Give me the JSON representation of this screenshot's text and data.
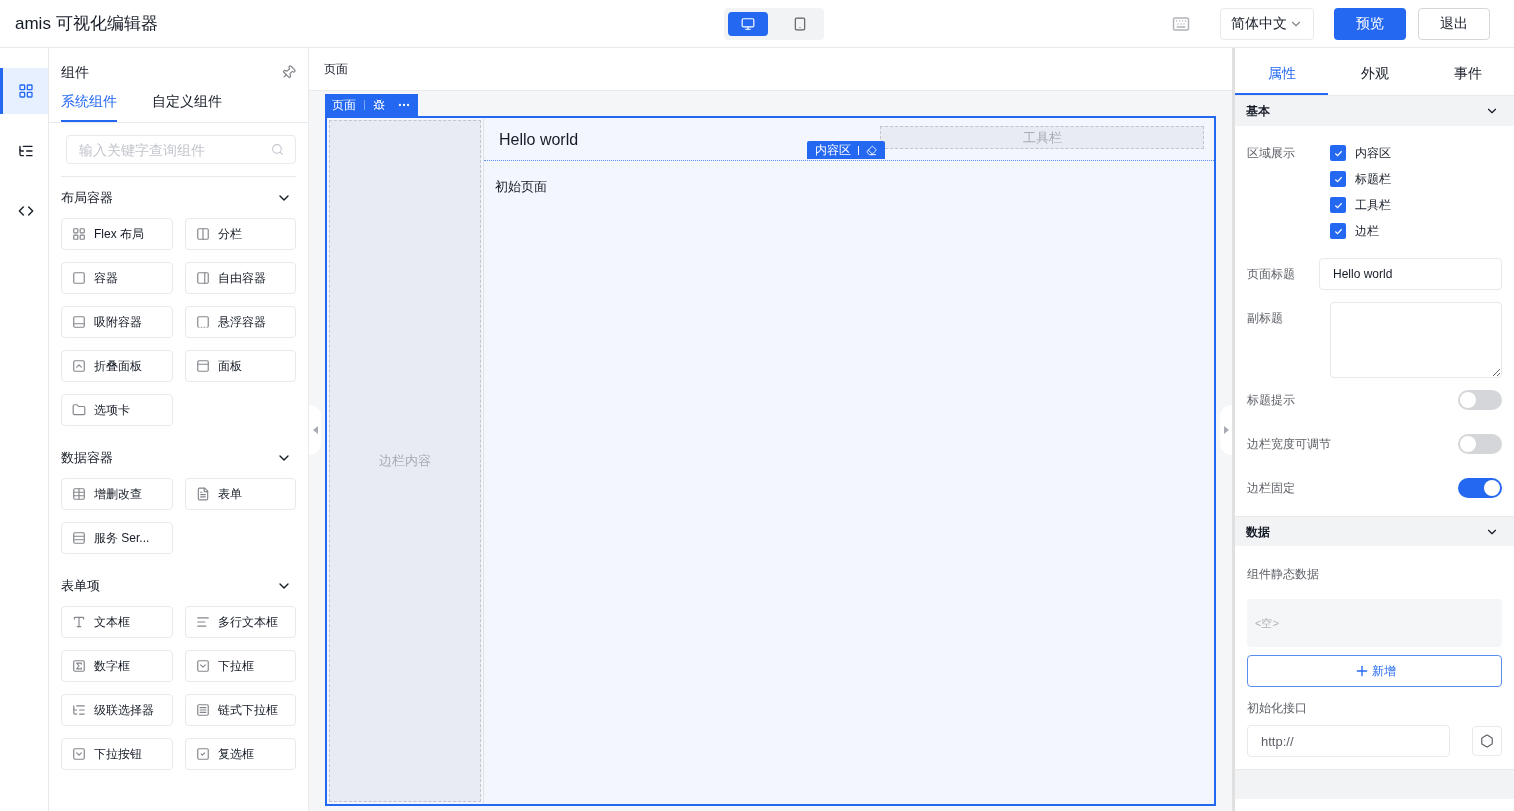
{
  "header": {
    "title": "amis 可视化编辑器",
    "devices": [
      {
        "kind": "desktop",
        "selected": true
      },
      {
        "kind": "tablet",
        "selected": false
      }
    ],
    "language": "简体中文",
    "buttons": [
      {
        "label": "预览",
        "kind": "primary"
      },
      {
        "label": "退出",
        "kind": "default"
      }
    ]
  },
  "rail": [
    {
      "kind": "components",
      "selected": true
    },
    {
      "kind": "outline",
      "selected": false
    },
    {
      "kind": "code",
      "selected": false
    }
  ],
  "components_panel": {
    "title": "组件",
    "tabs": [
      {
        "label": "系统组件",
        "selected": true
      },
      {
        "label": "自定义组件",
        "selected": false
      }
    ],
    "search": {
      "placeholder": "输入关键字查询组件"
    },
    "groups": [
      {
        "title": "布局容器",
        "expanded": true,
        "items": [
          {
            "label": "Flex 布局",
            "kind": "flex"
          },
          {
            "label": "分栏",
            "kind": "columns"
          },
          {
            "label": "容器",
            "kind": "container"
          },
          {
            "label": "自由容器",
            "kind": "free"
          },
          {
            "label": "吸附容器",
            "kind": "sticky"
          },
          {
            "label": "悬浮容器",
            "kind": "float"
          },
          {
            "label": "折叠面板",
            "kind": "collapse"
          },
          {
            "label": "面板",
            "kind": "panel"
          },
          {
            "label": "选项卡",
            "kind": "tabs"
          }
        ]
      },
      {
        "title": "数据容器",
        "expanded": true,
        "items": [
          {
            "label": "增删改查",
            "kind": "crud"
          },
          {
            "label": "表单",
            "kind": "form"
          },
          {
            "label": "服务 Ser...",
            "kind": "service"
          }
        ]
      },
      {
        "title": "表单项",
        "expanded": true,
        "items": [
          {
            "label": "文本框",
            "kind": "text"
          },
          {
            "label": "多行文本框",
            "kind": "textarea"
          },
          {
            "label": "数字框",
            "kind": "number"
          },
          {
            "label": "下拉框",
            "kind": "select"
          },
          {
            "label": "级联选择器",
            "kind": "cascader"
          },
          {
            "label": "链式下拉框",
            "kind": "chained"
          },
          {
            "label": "下拉按钮",
            "kind": "dropdown"
          },
          {
            "label": "复选框",
            "kind": "checkbox"
          }
        ]
      }
    ]
  },
  "canvas": {
    "breadcrumb": "页面",
    "page_tag": "页面",
    "title": "Hello world",
    "toolbar": "工具栏",
    "region_tag": "内容区",
    "body": "初始页面",
    "aside": "边栏内容"
  },
  "settings": {
    "tabs": [
      {
        "label": "属性",
        "selected": true
      },
      {
        "label": "外观",
        "selected": false
      },
      {
        "label": "事件",
        "selected": false
      }
    ],
    "basic": {
      "title": "基本",
      "expanded": true,
      "region_label": "区域展示",
      "regions": [
        {
          "label": "内容区",
          "checked": true
        },
        {
          "label": "标题栏",
          "checked": true
        },
        {
          "label": "工具栏",
          "checked": true
        },
        {
          "label": "边栏",
          "checked": true
        }
      ],
      "page_title": {
        "label": "页面标题",
        "value": "Hello world"
      },
      "subtitle": {
        "label": "副标题"
      },
      "switches": [
        {
          "label": "标题提示",
          "on": false
        },
        {
          "label": "边栏宽度可调节",
          "on": false
        },
        {
          "label": "边栏固定",
          "on": true
        }
      ]
    },
    "data": {
      "title": "数据",
      "expanded": true,
      "static_label": "组件静态数据",
      "empty": "<空>",
      "add_button": "新增",
      "init_label": "初始化接口",
      "init_value": "http://"
    }
  }
}
